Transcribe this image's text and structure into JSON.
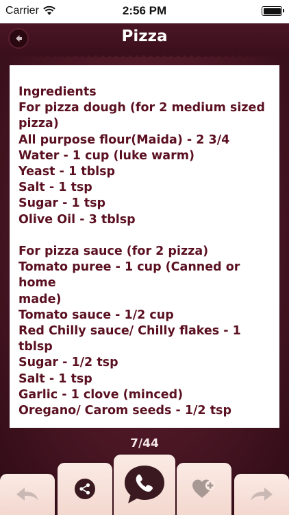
{
  "status_bar": {
    "carrier": "Carrier",
    "time": "2:56 PM"
  },
  "header": {
    "title": "Pizza"
  },
  "recipe": {
    "lines": [
      "Ingredients",
      "For pizza dough (for 2 medium sized",
      "pizza)",
      "All purpose flour(Maida) - 2 3/4",
      "Water - 1 cup (luke warm)",
      "Yeast - 1 tblsp",
      "Salt - 1 tsp",
      "Sugar - 1 tsp",
      "Olive Oil - 3 tblsp",
      "",
      "For pizza sauce (for 2 pizza)",
      "Tomato puree - 1 cup (Canned or home",
      "made)",
      "Tomato sauce - 1/2 cup",
      "Red Chilly sauce/ Chilly flakes - 1",
      "tblsp",
      "Sugar - 1/2 tsp",
      "Salt - 1 tsp",
      "Garlic - 1 clove (minced)",
      "Oregano/ Carom seeds - 1/2 tsp"
    ]
  },
  "pager": {
    "text": "7/44"
  },
  "toolbar": {
    "icons": [
      "arrow-left-icon",
      "share-icon",
      "phone-icon",
      "heart-plus-icon",
      "arrow-right-icon"
    ]
  },
  "colors": {
    "background": "#4a1624",
    "text": "#5a1020",
    "tab": "#fbeae4",
    "icon_dark": "#3a1a20",
    "icon_light": "#c9b8b4"
  }
}
